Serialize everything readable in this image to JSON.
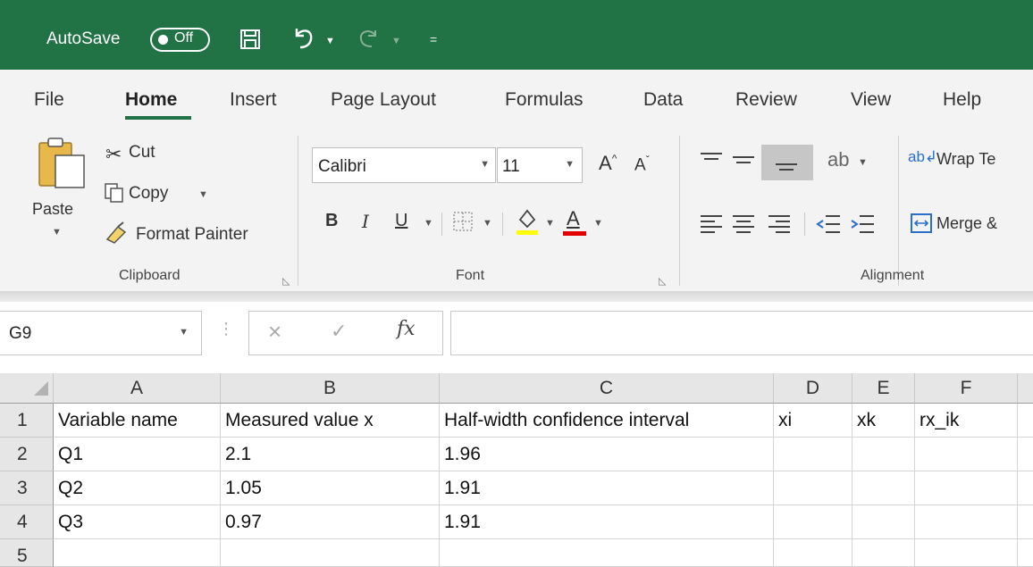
{
  "titlebar": {
    "autosave_label": "AutoSave",
    "autosave_state": "Off",
    "qat_more": "="
  },
  "menu_tabs": [
    {
      "label": "File"
    },
    {
      "label": "Home",
      "active": true
    },
    {
      "label": "Insert"
    },
    {
      "label": "Page Layout"
    },
    {
      "label": "Formulas"
    },
    {
      "label": "Data"
    },
    {
      "label": "Review"
    },
    {
      "label": "View"
    },
    {
      "label": "Help"
    }
  ],
  "ribbon": {
    "clipboard": {
      "paste": "Paste",
      "cut": "Cut",
      "copy": "Copy",
      "format_painter": "Format Painter",
      "group_label": "Clipboard"
    },
    "font": {
      "font_name": "Calibri",
      "font_size": "11",
      "bold": "B",
      "italic": "I",
      "underline": "U",
      "group_label": "Font",
      "highlight_color": "#ffff00",
      "font_color": "#e00000"
    },
    "alignment": {
      "wrap_text": "Wrap Te",
      "merge": "Merge &",
      "group_label": "Alignment"
    }
  },
  "formula_bar": {
    "name_box": "G9",
    "cancel_symbol": "×",
    "enter_symbol": "✓",
    "fx_symbol": "fx",
    "formula_value": ""
  },
  "sheet": {
    "columns": [
      "A",
      "B",
      "C",
      "D",
      "E",
      "F"
    ],
    "rows": [
      {
        "num": "1",
        "cells": [
          "Variable name",
          "Measured value x",
          "Half-width confidence interval",
          "xi",
          "xk",
          "rx_ik"
        ]
      },
      {
        "num": "2",
        "cells": [
          "Q1",
          "2.1",
          "1.96",
          "",
          "",
          ""
        ]
      },
      {
        "num": "3",
        "cells": [
          "Q2",
          "1.05",
          "1.91",
          "",
          "",
          ""
        ]
      },
      {
        "num": "4",
        "cells": [
          "Q3",
          "0.97",
          "1.91",
          "",
          "",
          ""
        ]
      },
      {
        "num": "5",
        "cells": [
          "",
          "",
          "",
          "",
          "",
          ""
        ]
      }
    ]
  },
  "colors": {
    "excel_green": "#217346",
    "ribbon_bg": "#f3f3f3",
    "header_bg": "#e6e6e6"
  }
}
